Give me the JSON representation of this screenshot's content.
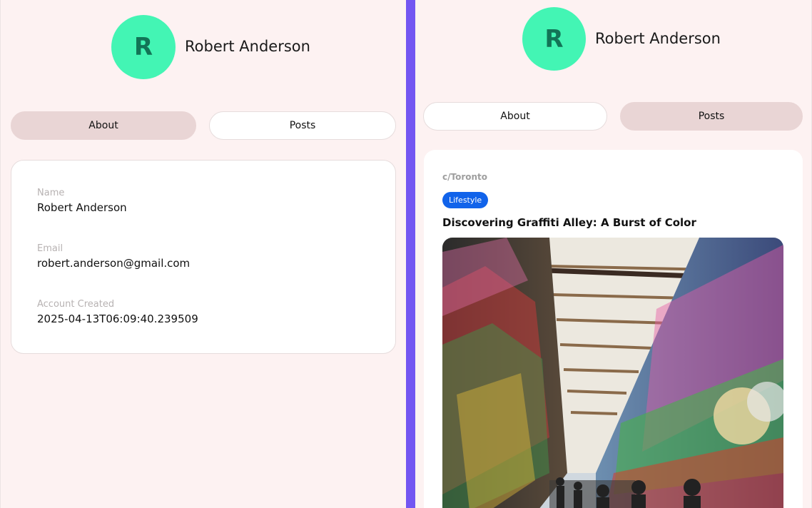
{
  "left_panel": {
    "avatar_initial": "R",
    "name": "Robert Anderson",
    "tabs": [
      {
        "label": "About",
        "active": true
      },
      {
        "label": "Posts",
        "active": false
      }
    ],
    "about": {
      "fields": [
        {
          "label": "Name",
          "value": "Robert Anderson"
        },
        {
          "label": "Email",
          "value": "robert.anderson@gmail.com"
        },
        {
          "label": "Account Created",
          "value": "2025-04-13T06:09:40.239509"
        }
      ]
    }
  },
  "right_panel": {
    "avatar_initial": "R",
    "name": "Robert Anderson",
    "tabs": [
      {
        "label": "About",
        "active": false
      },
      {
        "label": "Posts",
        "active": true
      }
    ],
    "post": {
      "community": "c/Toronto",
      "tag": "Lifestyle",
      "title": "Discovering Graffiti Alley: A Burst of Color",
      "image_alt": "graffiti-alley-photo"
    }
  },
  "colors": {
    "background": "#fdf2f2",
    "avatar": "#43f5b4",
    "avatar_text": "#127456",
    "active_tab": "#e9d5d5",
    "divider": "#7356f2",
    "tag": "#1163ea"
  }
}
